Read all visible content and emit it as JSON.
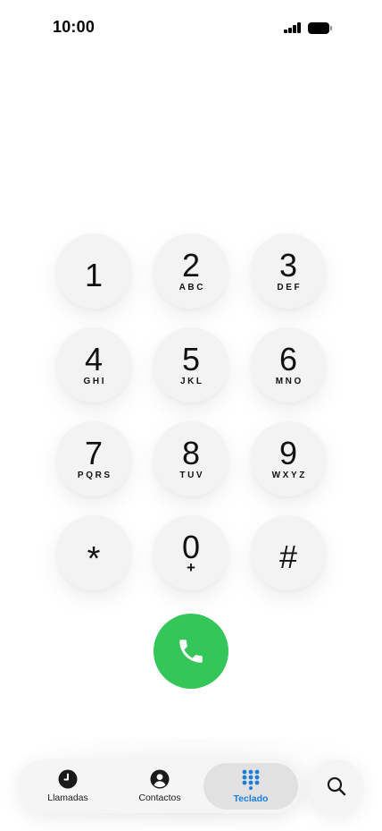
{
  "status_bar": {
    "time": "10:00",
    "signal_icon": "cellular-signal-icon",
    "battery_icon": "battery-icon"
  },
  "keypad": {
    "keys": [
      {
        "digit": "1",
        "letters": ""
      },
      {
        "digit": "2",
        "letters": "ABC"
      },
      {
        "digit": "3",
        "letters": "DEF"
      },
      {
        "digit": "4",
        "letters": "GHI"
      },
      {
        "digit": "5",
        "letters": "JKL"
      },
      {
        "digit": "6",
        "letters": "MNO"
      },
      {
        "digit": "7",
        "letters": "PQRS"
      },
      {
        "digit": "8",
        "letters": "TUV"
      },
      {
        "digit": "9",
        "letters": "WXYZ"
      },
      {
        "digit": "*",
        "letters": ""
      },
      {
        "digit": "0",
        "letters": "+"
      },
      {
        "digit": "#",
        "letters": ""
      }
    ]
  },
  "call_button": {
    "icon": "phone-icon",
    "color": "#34C659"
  },
  "tab_bar": {
    "tabs": [
      {
        "label": "Llamadas",
        "icon": "clock-icon",
        "active": false
      },
      {
        "label": "Contactos",
        "icon": "person-icon",
        "active": false
      },
      {
        "label": "Teclado",
        "icon": "keypad-grid-icon",
        "active": true
      }
    ],
    "active_color": "#1A7FDC"
  },
  "search": {
    "icon": "search-icon"
  }
}
